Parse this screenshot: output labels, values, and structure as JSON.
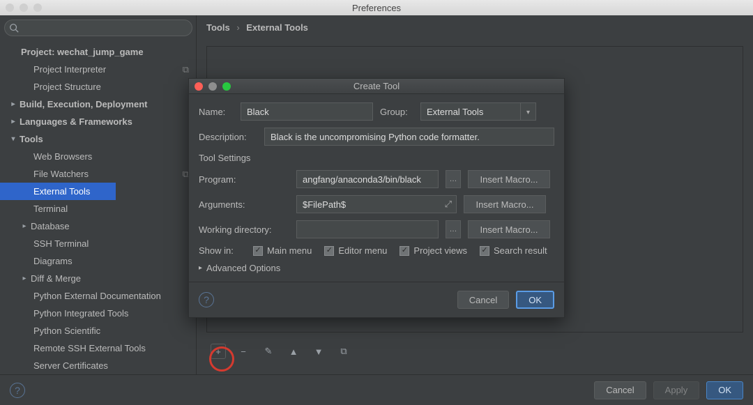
{
  "prefs": {
    "title": "Preferences",
    "search_placeholder": ""
  },
  "tree": {
    "project_heading": "Project: wechat_jump_game",
    "project_interpreter": "Project Interpreter",
    "project_structure": "Project Structure",
    "build": "Build, Execution, Deployment",
    "lang": "Languages & Frameworks",
    "tools": "Tools",
    "web_browsers": "Web Browsers",
    "file_watchers": "File Watchers",
    "external_tools": "External Tools",
    "terminal": "Terminal",
    "database": "Database",
    "ssh_terminal": "SSH Terminal",
    "diagrams": "Diagrams",
    "diff_merge": "Diff & Merge",
    "py_ext_doc": "Python External Documentation",
    "py_int_tools": "Python Integrated Tools",
    "py_sci": "Python Scientific",
    "remote_ssh": "Remote SSH External Tools",
    "server_cert": "Server Certificates"
  },
  "breadcrumb": {
    "a": "Tools",
    "b": "External Tools"
  },
  "toolbar": {
    "add": "+",
    "remove": "−",
    "edit": "✎",
    "up": "▲",
    "down": "▼",
    "copy": "⧉"
  },
  "footer": {
    "cancel": "Cancel",
    "apply": "Apply",
    "ok": "OK"
  },
  "dialog": {
    "title": "Create Tool",
    "name_label": "Name:",
    "name_value": "Black",
    "group_label": "Group:",
    "group_value": "External Tools",
    "desc_label": "Description:",
    "desc_value": "Black is the uncompromising Python code formatter.",
    "tool_settings": "Tool Settings",
    "program_label": "Program:",
    "program_value": "angfang/anaconda3/bin/black",
    "arguments_label": "Arguments:",
    "arguments_value": "$FilePath$",
    "workdir_label": "Working directory:",
    "workdir_value": "",
    "insert_macro": "Insert Macro...",
    "showin_label": "Show in:",
    "main_menu": "Main menu",
    "editor_menu": "Editor menu",
    "project_views": "Project views",
    "search_result": "Search result",
    "advanced": "Advanced Options",
    "cancel": "Cancel",
    "ok": "OK"
  }
}
